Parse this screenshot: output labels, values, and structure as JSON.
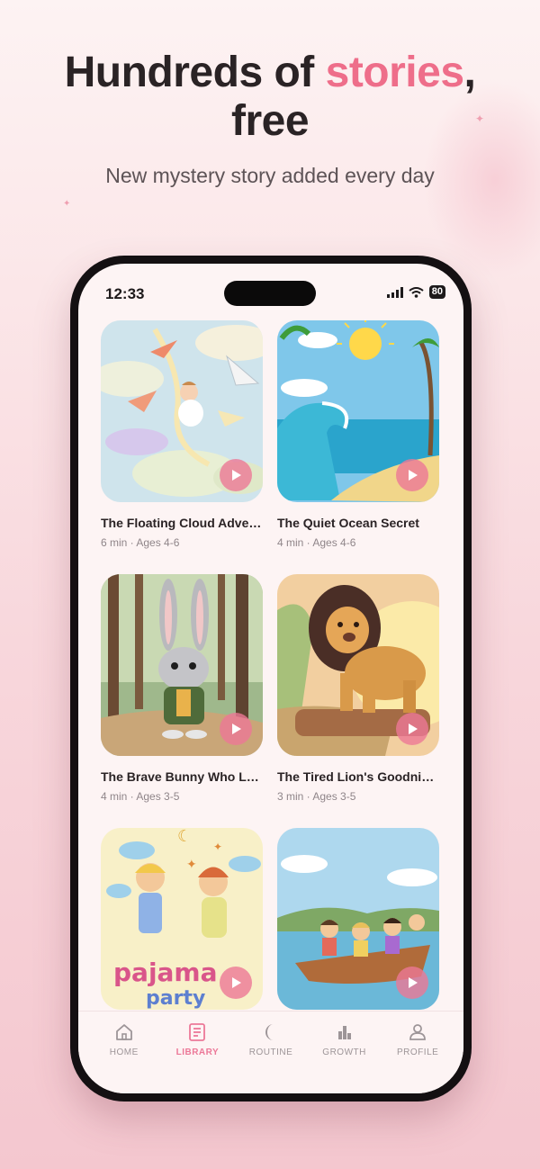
{
  "headline": {
    "part1": "Hundreds of ",
    "accent": "stories",
    "part2": ",",
    "line2": "free"
  },
  "subheadline": "New mystery story added every day",
  "status_bar": {
    "time": "12:33",
    "battery": "80"
  },
  "stories": [
    {
      "title": "The Floating Cloud Adve…",
      "meta": "6 min · Ages 4-6",
      "art": "paper-planes-clouds"
    },
    {
      "title": "The Quiet Ocean Secret",
      "meta": "4 min · Ages 4-6",
      "art": "ocean-wave-beach"
    },
    {
      "title": "The Brave Bunny Who Le…",
      "meta": "4 min · Ages 3-5",
      "art": "bunny-forest"
    },
    {
      "title": "The Tired Lion's Goodnight",
      "meta": "3 min · Ages 3-5",
      "art": "lion-cliff-sunset"
    },
    {
      "title": "",
      "meta": "",
      "art": "pajama-party"
    },
    {
      "title": "",
      "meta": "",
      "art": "kids-boat-lake"
    }
  ],
  "pajama_art_text": {
    "line1": "pajama",
    "line2": "party"
  },
  "tabs": [
    {
      "label": "HOME",
      "icon": "home-icon",
      "active": false
    },
    {
      "label": "LIBRARY",
      "icon": "library-icon",
      "active": true
    },
    {
      "label": "ROUTINE",
      "icon": "moon-icon",
      "active": false
    },
    {
      "label": "GROWTH",
      "icon": "bar-chart-icon",
      "active": false
    },
    {
      "label": "PROFILE",
      "icon": "profile-icon",
      "active": false
    }
  ],
  "colors": {
    "accent": "#ee6e8a",
    "active_tab": "#ec7898",
    "text_dark": "#2a2325",
    "text_muted": "#8f8589"
  }
}
